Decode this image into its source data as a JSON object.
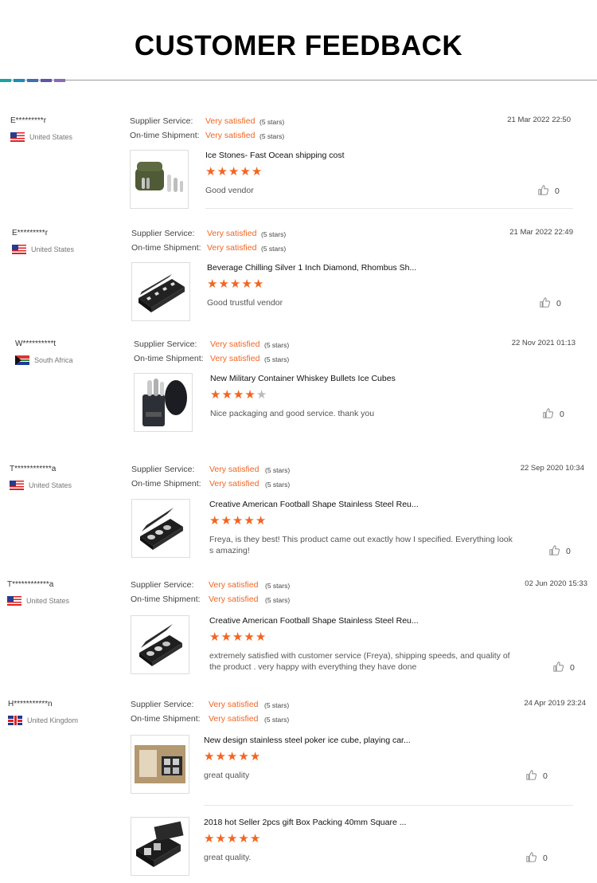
{
  "page": {
    "title": "CUSTOMER FEEDBACK"
  },
  "accent_colors": [
    "#1aa3a3",
    "#1a8cb8",
    "#3d6fb5",
    "#5b55a6",
    "#8a6ab8"
  ],
  "labels": {
    "supplier": "Supplier Service:",
    "ontime": "On-time Shipment:"
  },
  "reviews": [
    {
      "user": "E*********r",
      "country": "United States",
      "flag": "us",
      "date": "21 Mar 2022 22:50",
      "supplier": "Very satisfied",
      "supplier_stars": "(5 stars)",
      "ontime": "Very satisfied",
      "ontime_stars": "(5 stars)",
      "product": "Ice Stones- Fast Ocean shipping cost",
      "rating": 5,
      "comment": "Good vendor",
      "likes": "0",
      "thumb_icon": "ice-stones-case"
    },
    {
      "user": "E*********r",
      "country": "United States",
      "flag": "us",
      "date": "21 Mar 2022 22:49",
      "supplier": "Very satisfied",
      "supplier_stars": "(5 stars)",
      "ontime": "Very satisfied",
      "ontime_stars": "(5 stars)",
      "product": "Beverage Chilling Silver 1 Inch Diamond, Rhombus Sh...",
      "rating": 5,
      "comment": "Good trustful vendor",
      "likes": "0",
      "thumb_icon": "black-gift-box"
    },
    {
      "user": "W**********t",
      "country": "South Africa",
      "flag": "za",
      "date": "22 Nov 2021 01:13",
      "supplier": "Very satisfied",
      "supplier_stars": "(5 stars)",
      "ontime": "Very satisfied",
      "ontime_stars": "(5 stars)",
      "product": "New Military Container Whiskey Bullets Ice Cubes",
      "rating": 4,
      "comment": "Nice packaging and good service. thank you",
      "likes": "0",
      "thumb_icon": "bullet-container"
    },
    {
      "user": "T************a",
      "country": "United States",
      "flag": "us",
      "date": "22 Sep 2020 10:34",
      "supplier": "Very satisfied",
      "supplier_stars": "(5 stars)",
      "ontime": "Very satisfied",
      "ontime_stars": "(5 stars)",
      "product": "Creative American Football Shape Stainless Steel Reu...",
      "rating": 5,
      "comment": "Freya, is they best! This product came out exactly how I specified. Everything look",
      "comment2": "s amazing!",
      "likes": "0",
      "thumb_icon": "football-gift-box"
    },
    {
      "user": "T************a",
      "country": "United States",
      "flag": "us",
      "date": "02 Jun 2020 15:33",
      "supplier": "Very satisfied",
      "supplier_stars": "(5 stars)",
      "ontime": "Very satisfied",
      "ontime_stars": "(5 stars)",
      "product": "Creative American Football Shape Stainless Steel Reu...",
      "rating": 5,
      "comment": "extremely satisfied with customer service (Freya), shipping speeds, and quality of",
      "comment2": "the product . very happy with everything they have done",
      "likes": "0",
      "thumb_icon": "football-gift-box"
    },
    {
      "user": "H***********n",
      "country": "United Kingdom",
      "flag": "uk",
      "date": "24 Apr 2019 23:24",
      "supplier": "Very satisfied",
      "supplier_stars": "(5 stars)",
      "ontime": "Very satisfied",
      "ontime_stars": "(5 stars)",
      "product": "New design stainless steel poker ice cube, playing car...",
      "rating": 5,
      "comment": "great quality",
      "likes": "0",
      "thumb_icon": "poker-cube-box",
      "extra": {
        "product": "2018 hot Seller 2pcs gift Box Packing 40mm Square ...",
        "rating": 5,
        "comment": "great quality.",
        "likes": "0",
        "thumb_icon": "square-cube-box"
      }
    }
  ]
}
